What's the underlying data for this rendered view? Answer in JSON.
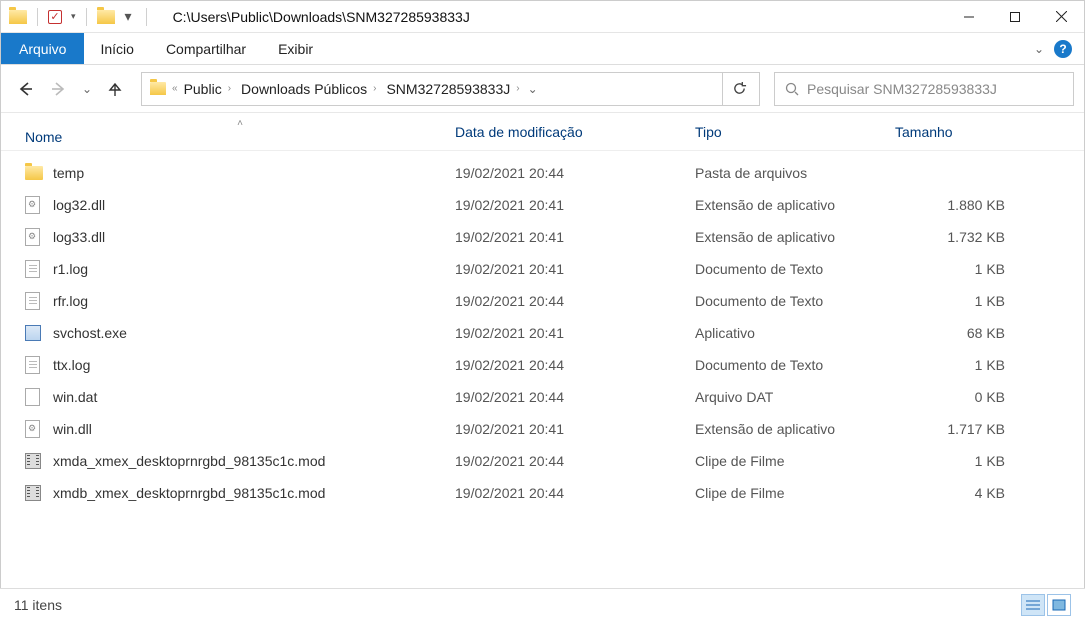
{
  "window": {
    "path": "C:\\Users\\Public\\Downloads\\SNM32728593833J"
  },
  "ribbon": {
    "file": "Arquivo",
    "home": "Início",
    "share": "Compartilhar",
    "view": "Exibir"
  },
  "breadcrumb": {
    "items": [
      "Public",
      "Downloads Públicos",
      "SNM32728593833J"
    ]
  },
  "search": {
    "placeholder": "Pesquisar SNM32728593833J"
  },
  "columns": {
    "name": "Nome",
    "date": "Data de modificação",
    "type": "Tipo",
    "size": "Tamanho"
  },
  "files": [
    {
      "icon": "folder",
      "name": "temp",
      "date": "19/02/2021 20:44",
      "type": "Pasta de arquivos",
      "size": ""
    },
    {
      "icon": "dll",
      "name": "log32.dll",
      "date": "19/02/2021 20:41",
      "type": "Extensão de aplicativo",
      "size": "1.880 KB"
    },
    {
      "icon": "dll",
      "name": "log33.dll",
      "date": "19/02/2021 20:41",
      "type": "Extensão de aplicativo",
      "size": "1.732 KB"
    },
    {
      "icon": "txt",
      "name": "r1.log",
      "date": "19/02/2021 20:41",
      "type": "Documento de Texto",
      "size": "1 KB"
    },
    {
      "icon": "txt",
      "name": "rfr.log",
      "date": "19/02/2021 20:44",
      "type": "Documento de Texto",
      "size": "1 KB"
    },
    {
      "icon": "exe",
      "name": "svchost.exe",
      "date": "19/02/2021 20:41",
      "type": "Aplicativo",
      "size": "68 KB"
    },
    {
      "icon": "txt",
      "name": "ttx.log",
      "date": "19/02/2021 20:44",
      "type": "Documento de Texto",
      "size": "1 KB"
    },
    {
      "icon": "doc",
      "name": "win.dat",
      "date": "19/02/2021 20:44",
      "type": "Arquivo DAT",
      "size": "0 KB"
    },
    {
      "icon": "dll",
      "name": "win.dll",
      "date": "19/02/2021 20:41",
      "type": "Extensão de aplicativo",
      "size": "1.717 KB"
    },
    {
      "icon": "mov",
      "name": "xmda_xmex_desktoprnrgbd_98135c1c.mod",
      "date": "19/02/2021 20:44",
      "type": "Clipe de Filme",
      "size": "1 KB"
    },
    {
      "icon": "mov",
      "name": "xmdb_xmex_desktoprnrgbd_98135c1c.mod",
      "date": "19/02/2021 20:44",
      "type": "Clipe de Filme",
      "size": "4 KB"
    }
  ],
  "status": {
    "count": "11 itens"
  }
}
